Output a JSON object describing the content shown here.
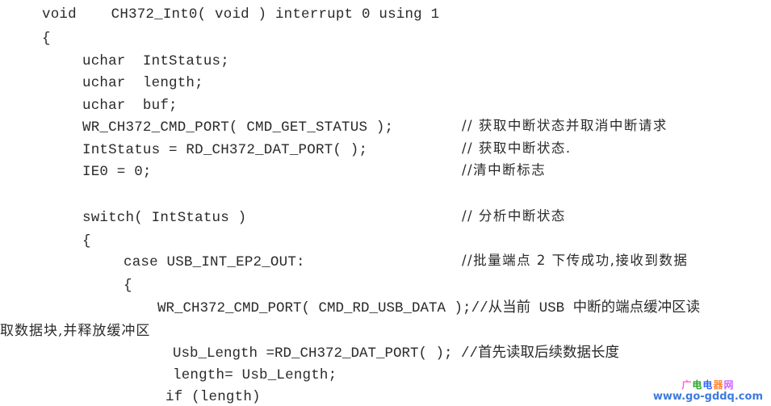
{
  "document": {
    "lines": [
      {
        "code": "void    CH372_Int0( void ) interrupt 0 using 1",
        "comment": ""
      },
      {
        "code": "{",
        "comment": ""
      },
      {
        "code": "uchar  IntStatus;",
        "comment": ""
      },
      {
        "code": "uchar  length;",
        "comment": ""
      },
      {
        "code": "uchar  buf;",
        "comment": ""
      },
      {
        "code": "WR_CH372_CMD_PORT( CMD_GET_STATUS );",
        "comment": "// 获取中断状态并取消中断请求"
      },
      {
        "code": "IntStatus = RD_CH372_DAT_PORT( );",
        "comment": "// 获取中断状态."
      },
      {
        "code": "IE0 = 0;",
        "comment": "//清中断标志"
      },
      {
        "code": "",
        "comment": ""
      },
      {
        "code": "switch( IntStatus )",
        "comment": "// 分析中断状态"
      },
      {
        "code": "{",
        "comment": ""
      },
      {
        "code": "case USB_INT_EP2_OUT:",
        "comment": "//批量端点 2 下传成功,接收到数据"
      },
      {
        "code": "{",
        "comment": ""
      },
      {
        "code": "WR_CH372_CMD_PORT( CMD_RD_USB_DATA );//从当前 USB 中断的端点缓冲区读",
        "comment": ""
      },
      {
        "code": "取数据块,并释放缓冲区",
        "comment": ""
      },
      {
        "code": "Usb_Length =RD_CH372_DAT_PORT( ); //首先读取后续数据长度",
        "comment": ""
      },
      {
        "code": "length= Usb_Length;",
        "comment": ""
      },
      {
        "code": "if (length)",
        "comment": ""
      }
    ]
  },
  "watermark": {
    "title_chars": [
      "广",
      "电",
      "电",
      "器",
      "网"
    ],
    "url": "www.go-gddq.com"
  }
}
